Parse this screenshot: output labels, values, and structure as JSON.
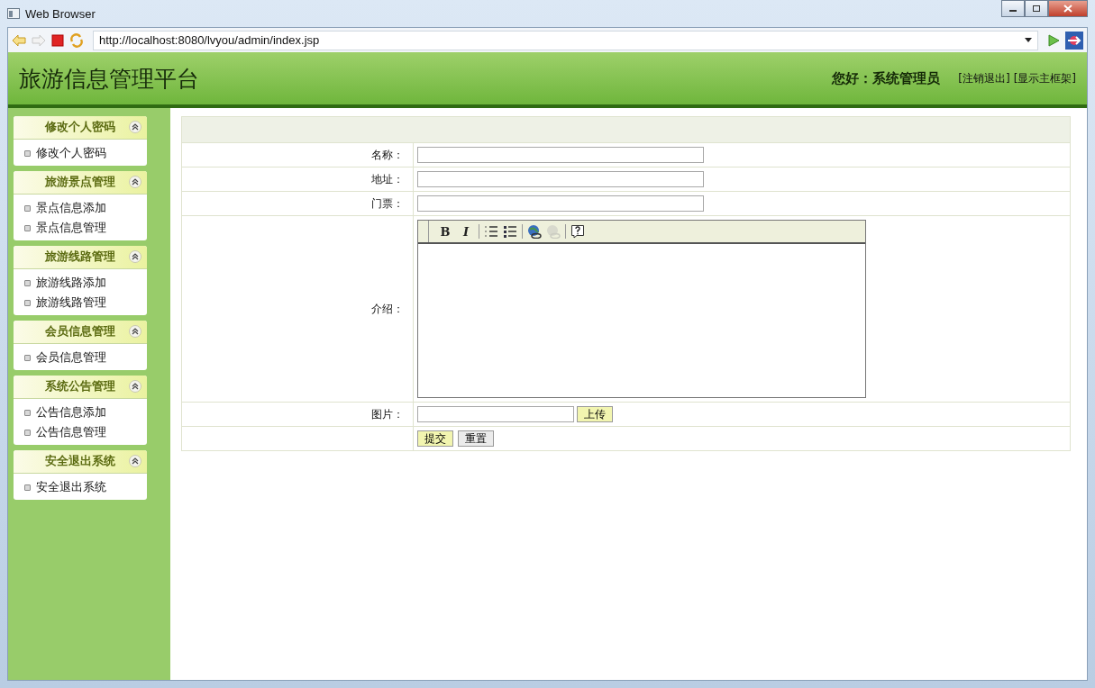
{
  "window": {
    "title": "Web Browser"
  },
  "toolbar": {
    "url": "http://localhost:8080/lvyou/admin/index.jsp"
  },
  "header": {
    "title": "旅游信息管理平台",
    "greeting": "您好：系统管理员",
    "links": [
      "[注销退出]",
      "[显示主框架]"
    ]
  },
  "sidebar": {
    "sections": [
      {
        "title": "修改个人密码",
        "expanded": true,
        "items": [
          "修改个人密码"
        ]
      },
      {
        "title": "旅游景点管理",
        "expanded": true,
        "items": [
          "景点信息添加",
          "景点信息管理"
        ]
      },
      {
        "title": "旅游线路管理",
        "expanded": true,
        "items": [
          "旅游线路添加",
          "旅游线路管理"
        ]
      },
      {
        "title": "会员信息管理",
        "expanded": true,
        "items": [
          "会员信息管理"
        ]
      },
      {
        "title": "系统公告管理",
        "expanded": true,
        "items": [
          "公告信息添加",
          "公告信息管理"
        ]
      },
      {
        "title": "安全退出系统",
        "expanded": true,
        "items": [
          "安全退出系统"
        ]
      }
    ]
  },
  "form": {
    "fields": [
      {
        "kind": "text",
        "label": "名称："
      },
      {
        "kind": "text",
        "label": "地址："
      },
      {
        "kind": "text",
        "label": "门票："
      },
      {
        "kind": "editor",
        "label": "介绍：",
        "tool_groups": [
          [
            {
              "kind": "bold",
              "label": "B",
              "disabled": false
            },
            {
              "kind": "italic",
              "label": "I",
              "disabled": false
            }
          ],
          [
            {
              "kind": "ordered-list",
              "disabled": false
            },
            {
              "kind": "bullet-list",
              "disabled": false
            }
          ],
          [
            {
              "kind": "link",
              "disabled": false
            },
            {
              "kind": "unlink",
              "disabled": true
            }
          ],
          [
            {
              "kind": "help",
              "disabled": false
            }
          ]
        ]
      },
      {
        "kind": "file",
        "label": "图片：",
        "button": "上传"
      }
    ],
    "buttons": [
      {
        "kind": "submit",
        "label": "提交"
      },
      {
        "kind": "reset",
        "label": "重置"
      }
    ]
  }
}
